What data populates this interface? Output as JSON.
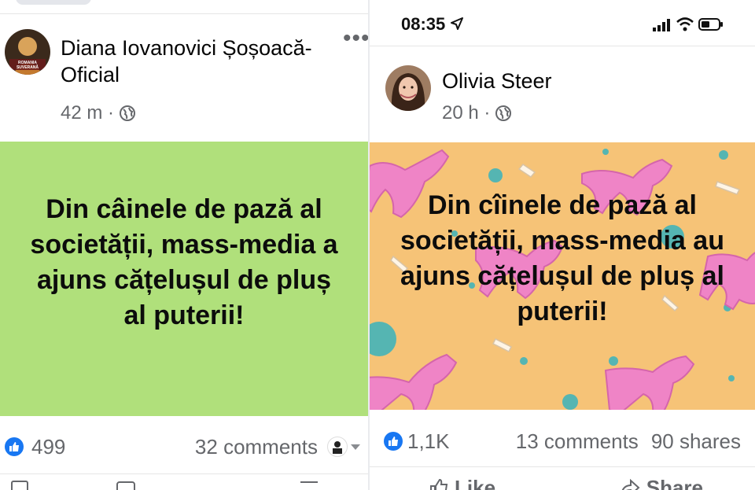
{
  "left": {
    "author": "Diana Iovanovici Șoșoacă- Oficial",
    "avatar_label": "ROMANIA SUVERANĂ",
    "time": "42 m ·",
    "post_text": "Din câinele de pază al societății, mass-media a ajuns cățelușul de pluș al puterii!",
    "likes": "499",
    "comments": "32 comments",
    "banner_color": "#b0e07b"
  },
  "right": {
    "clock": "08:35",
    "author": "Olivia Steer",
    "time": "20 h ·",
    "post_text": "Din cîinele de pază al societății, mass-media au ajuns cățelușul de pluș al puterii!",
    "likes": "1,1K",
    "comments": "13 comments",
    "shares": "90 shares",
    "like_label": "Like",
    "share_label": "Share",
    "banner_color": "#f6c377"
  },
  "colors": {
    "facebook_blue": "#1877f2",
    "dog_pink": "#ef84c6",
    "dot_teal": "#55b5b2"
  },
  "icons": [
    "globe-icon",
    "more-options-icon",
    "like-reaction-icon",
    "location-arrow-icon",
    "signal-icon",
    "wifi-icon",
    "battery-icon",
    "like-button-icon",
    "share-button-icon"
  ]
}
